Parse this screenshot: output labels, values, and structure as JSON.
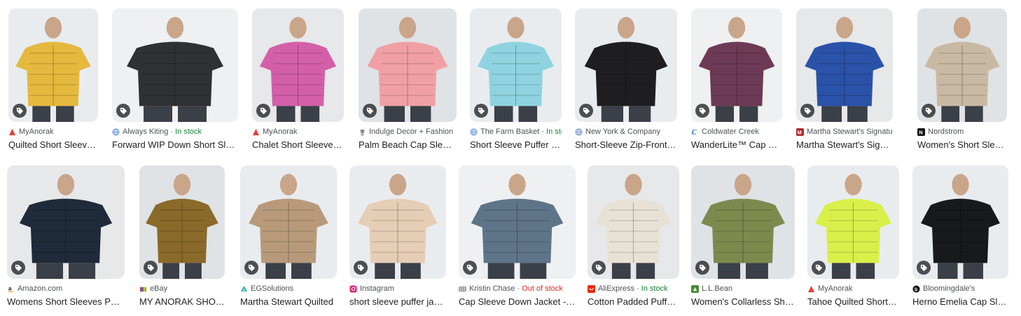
{
  "colors": {
    "bg": "#ffffff",
    "source_text": "#4d5156",
    "title_text": "#202124",
    "in_stock": "#188038",
    "out_of_stock": "#d93025"
  },
  "row1": [
    {
      "source": "MyAnorak",
      "stock": "",
      "title": "Quilted Short Sleeve Vest",
      "favicon": "red-triangle-icon",
      "product_color": "#e5b93e"
    },
    {
      "source": "Always Kiting",
      "stock": "In stock",
      "title": "Forward WIP Down Short Sleeve",
      "favicon": "globe-icon",
      "product_color": "#2f3133"
    },
    {
      "source": "MyAnorak",
      "stock": "",
      "title": "Chalet Short Sleeve Jacket",
      "favicon": "red-triangle-icon",
      "product_color": "#d35fa8"
    },
    {
      "source": "Indulge Decor + Fashion",
      "stock": "",
      "title": "Palm Beach Cap Sleeve",
      "favicon": "trophy-icon",
      "product_color": "#f0a0a4"
    },
    {
      "source": "The Farm Basket",
      "stock": "In stock",
      "title": "Short Sleeve Puffer Vest",
      "favicon": "globe-icon",
      "product_color": "#8fd3e0"
    },
    {
      "source": "New York & Company",
      "stock": "",
      "title": "Short-Sleeve Zip-Front Puffer",
      "favicon": "globe-icon",
      "product_color": "#1e1e20"
    },
    {
      "source": "Coldwater Creek",
      "stock": "",
      "title": "WanderLite™ Cap Sleeve",
      "favicon": "c-letter-icon",
      "product_color": "#6d3a55"
    },
    {
      "source": "Martha Stewart's Signature",
      "stock": "",
      "title": "Martha Stewart's Signature",
      "favicon": "m-letter-icon",
      "product_color": "#2a52a8"
    },
    {
      "source": "Nordstrom",
      "stock": "",
      "title": "Women's Short Sleeve",
      "favicon": "n-letter-icon",
      "product_color": "#c9b9a2"
    }
  ],
  "row2": [
    {
      "source": "Amazon.com",
      "stock": "",
      "title": "Womens Short Sleeves Puffer",
      "favicon": "amazon-icon",
      "product_color": "#1f2a3a"
    },
    {
      "source": "eBay",
      "stock": "",
      "title": "MY ANORAK SHORT SLEEVE",
      "favicon": "ebay-icon",
      "product_color": "#8a6a2a"
    },
    {
      "source": "EGSolutions",
      "stock": "",
      "title": "Martha Stewart Quilted",
      "favicon": "egsolutions-icon",
      "product_color": "#b89a7a"
    },
    {
      "source": "Instagram",
      "stock": "",
      "title": "short sleeve puffer jacket",
      "favicon": "instagram-icon",
      "product_color": "#e6cdb6"
    },
    {
      "source": "Kristin Chase",
      "stock": "Out of stock",
      "title": "Cap Sleeve Down Jacket - Blue",
      "favicon": "grid-icon",
      "product_color": "#5d7489"
    },
    {
      "source": "AliExpress",
      "stock": "In stock",
      "title": "Cotton Padded Puffer Vest",
      "favicon": "aliexpress-icon",
      "product_color": "#e8e2d6"
    },
    {
      "source": "L.L.Bean",
      "stock": "",
      "title": "Women's Collarless Short Sleeve",
      "favicon": "llbean-icon",
      "product_color": "#7c8a4e"
    },
    {
      "source": "MyAnorak",
      "stock": "",
      "title": "Tahoe Quilted Short Sleeve",
      "favicon": "red-triangle-icon",
      "product_color": "#d9ef4a"
    },
    {
      "source": "Bloomingdale's",
      "stock": "",
      "title": "Herno Emelia Cap Sleeve",
      "favicon": "b-letter-icon",
      "product_color": "#18191c"
    }
  ]
}
